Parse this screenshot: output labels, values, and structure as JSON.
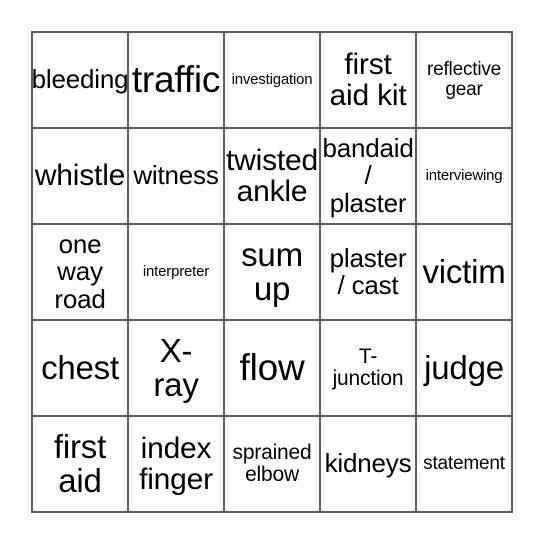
{
  "card": {
    "type": "bingo-card",
    "columns": 5,
    "rows": 5,
    "border_color": "#5e5e5e",
    "background_color": "#ffffff",
    "text_color": "#000000",
    "cells": [
      {
        "text": "bleeding",
        "row": 1,
        "col": 1,
        "size": "md"
      },
      {
        "text": "traffic",
        "row": 1,
        "col": 2,
        "size": "xxl"
      },
      {
        "text": "investigation",
        "row": 1,
        "col": 3,
        "size": "xxs"
      },
      {
        "text": "first\naid kit",
        "row": 1,
        "col": 4,
        "size": "lg"
      },
      {
        "text": "reflective\ngear",
        "row": 1,
        "col": 5,
        "size": "xs"
      },
      {
        "text": "whistle",
        "row": 2,
        "col": 1,
        "size": "lg"
      },
      {
        "text": "witness",
        "row": 2,
        "col": 2,
        "size": "md"
      },
      {
        "text": "twisted\nankle",
        "row": 2,
        "col": 3,
        "size": "lg"
      },
      {
        "text": "bandaid\n/\nplaster",
        "row": 2,
        "col": 4,
        "size": "md"
      },
      {
        "text": "interviewing",
        "row": 2,
        "col": 5,
        "size": "xxs"
      },
      {
        "text": "one\nway\nroad",
        "row": 3,
        "col": 1,
        "size": "md"
      },
      {
        "text": "interpreter",
        "row": 3,
        "col": 2,
        "size": "xxs"
      },
      {
        "text": "sum\nup",
        "row": 3,
        "col": 3,
        "size": "xl"
      },
      {
        "text": "plaster\n/ cast",
        "row": 3,
        "col": 4,
        "size": "md"
      },
      {
        "text": "victim",
        "row": 3,
        "col": 5,
        "size": "xl"
      },
      {
        "text": "chest",
        "row": 4,
        "col": 1,
        "size": "xl"
      },
      {
        "text": "X-\nray",
        "row": 4,
        "col": 2,
        "size": "xl"
      },
      {
        "text": "flow",
        "row": 4,
        "col": 3,
        "size": "xxl"
      },
      {
        "text": "T-\njunction",
        "row": 4,
        "col": 4,
        "size": "sm"
      },
      {
        "text": "judge",
        "row": 4,
        "col": 5,
        "size": "xl"
      },
      {
        "text": "first\naid",
        "row": 5,
        "col": 1,
        "size": "xl"
      },
      {
        "text": "index\nfinger",
        "row": 5,
        "col": 2,
        "size": "lg"
      },
      {
        "text": "sprained\nelbow",
        "row": 5,
        "col": 3,
        "size": "sm"
      },
      {
        "text": "kidneys",
        "row": 5,
        "col": 4,
        "size": "md"
      },
      {
        "text": "statement",
        "row": 5,
        "col": 5,
        "size": "xs"
      }
    ]
  }
}
